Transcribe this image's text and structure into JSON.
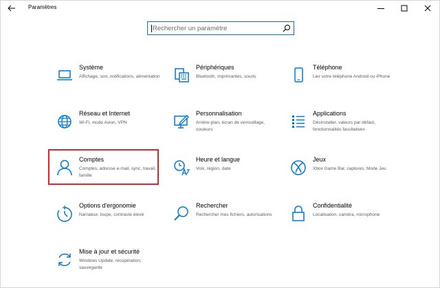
{
  "window": {
    "title": "Paramètres",
    "back_icon": "back-arrow-icon",
    "controls": [
      "minimize-icon",
      "maximize-icon",
      "close-icon"
    ]
  },
  "search": {
    "placeholder": "Rechercher un paramètre",
    "icon": "search-icon"
  },
  "accent_color": "#0078d7",
  "highlight_color": "#d9262b",
  "tiles": [
    {
      "id": "systeme",
      "title": "Système",
      "description": "Affichage, son, notifications, alimentation",
      "icon": "laptop-icon"
    },
    {
      "id": "peripheriques",
      "title": "Périphériques",
      "description": "Bluetooth, imprimantes, souris",
      "icon": "keyboard-icon"
    },
    {
      "id": "telephone",
      "title": "Téléphone",
      "description": "Lier votre téléphone Android ou iPhone",
      "icon": "phone-icon"
    },
    {
      "id": "reseau",
      "title": "Réseau et Internet",
      "description": "Wi-Fi, mode Avion, VPN",
      "icon": "globe-icon"
    },
    {
      "id": "personnalisation",
      "title": "Personnalisation",
      "description": "Arrière-plan, écran de verrouillage, couleurs",
      "icon": "paint-icon"
    },
    {
      "id": "applications",
      "title": "Applications",
      "description": "Désinstaller, valeurs par défaut, fonctionnalités facultatives",
      "icon": "apps-list-icon"
    },
    {
      "id": "comptes",
      "title": "Comptes",
      "description": "Comptes, adresse e-mail, sync, travail, famille",
      "icon": "person-icon"
    },
    {
      "id": "heure",
      "title": "Heure et langue",
      "description": "Voix, région, date",
      "icon": "time-language-icon"
    },
    {
      "id": "jeux",
      "title": "Jeux",
      "description": "Xbox Game Bar, captures, Mode Jeu",
      "icon": "xbox-icon"
    },
    {
      "id": "ergonomie",
      "title": "Options d'ergonomie",
      "description": "Narrateur, loupe, contraste élevé",
      "icon": "ease-of-access-icon"
    },
    {
      "id": "rechercher",
      "title": "Rechercher",
      "description": "Rechercher mes fichiers, autorisations",
      "icon": "magnifier-icon"
    },
    {
      "id": "confidentialite",
      "title": "Confidentialité",
      "description": "Localisation, caméra, microphone",
      "icon": "lock-icon"
    },
    {
      "id": "maj",
      "title": "Mise à jour et sécurité",
      "description": "Windows Update, récupération, sauvegarde",
      "icon": "update-icon"
    }
  ]
}
